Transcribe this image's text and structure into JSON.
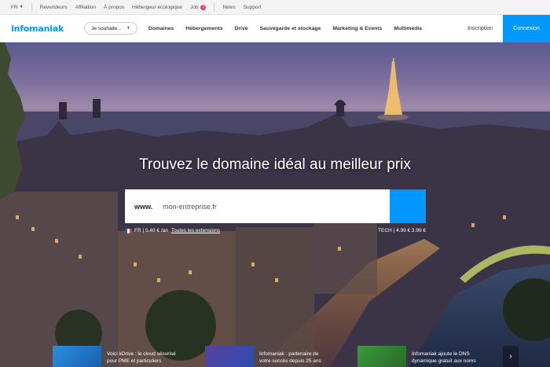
{
  "topbar": {
    "lang": "FR",
    "items": [
      "Revendeurs",
      "Affiliation",
      "À propos",
      "Hébergeur écologique",
      "Job"
    ],
    "job_badge": "1",
    "items2": [
      "News",
      "Support"
    ]
  },
  "header": {
    "logo": "infomaniak",
    "dropdown_label": "Je souhaite...",
    "nav": [
      "Domaines",
      "Hébergements",
      "Drive",
      "Sauvegarde et stockage",
      "Marketing & Events",
      "Multimédia"
    ],
    "inscription": "Inscription",
    "connexion": "Connexion"
  },
  "hero": {
    "headline": "Trouvez le domaine idéal au meilleur prix",
    "search": {
      "prefix": "www.",
      "placeholder": "mon-entreprise.fr"
    },
    "ext_left": {
      "tld": "FR",
      "price": "5.40 € /an",
      "link": "Toutes les extensions"
    },
    "ext_right": "TECH | 4.99 € 3.99 €"
  },
  "news": [
    {
      "line1": "Voici kDrive : le cloud sécurisé",
      "line2": "pour PME et particuliers"
    },
    {
      "line1": "Infomaniak : partenaire de",
      "line2": "votre succès depuis 25 ans"
    },
    {
      "line1": "Infomaniak ajoute le DNS",
      "line2": "dynamique gratuit aux noms"
    }
  ],
  "colors": {
    "brand": "#0098ff",
    "badge": "#e8386d"
  }
}
